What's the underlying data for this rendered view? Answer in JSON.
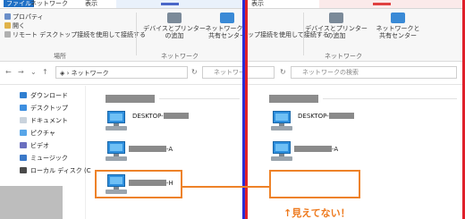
{
  "left": {
    "tabs": [
      "ファイル",
      "ネットワーク",
      "表示"
    ],
    "ribbon": {
      "properties": "プロパティ",
      "open": "開く",
      "remote": "リモート デスクトップ接続を使用して接続する",
      "group_location": "場所",
      "devices": "デバイスとプリンター\nの追加",
      "network_center": "ネットワークと\n共有センター",
      "group_network": "ネットワーク"
    },
    "address": {
      "path": "ネットワーク",
      "search_placeholder": "ネットワー"
    },
    "sidebar": [
      "ダウンロード",
      "デスクトップ",
      "ドキュメント",
      "ピクチャ",
      "ビデオ",
      "ミュージック",
      "ローカル ディスク (C"
    ],
    "computers": [
      {
        "prefix": "DESKTOP-",
        "suffix": ""
      },
      {
        "prefix": "",
        "suffix": "-A"
      },
      {
        "prefix": "",
        "suffix": "-H"
      }
    ]
  },
  "right": {
    "tabs": [
      "表示"
    ],
    "ribbon": {
      "remote": "ップ接続を使用して接続する",
      "devices": "デバイスとプリンター\nの追加",
      "network_center": "ネットワークと\n共有センター",
      "group_network": "ネットワーク"
    },
    "address": {
      "search_placeholder": "ネットワークの検索",
      "path": "ネットワーク"
    },
    "computers": [
      {
        "prefix": "DESKTOP-",
        "suffix": ""
      },
      {
        "prefix": "",
        "suffix": "-A"
      }
    ],
    "annotation": "↑見えてない！"
  },
  "colors": {
    "blue_divider": "#2b2bd6",
    "red_divider": "#e0202a",
    "highlight": "#ee8228"
  }
}
